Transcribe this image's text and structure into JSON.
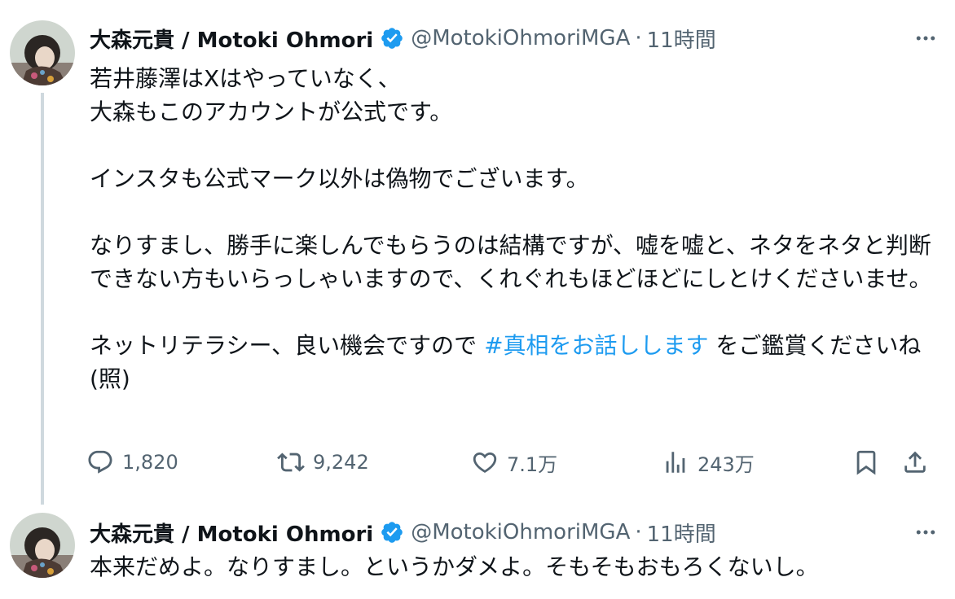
{
  "tweets": [
    {
      "display_name": "大森元貴 / Motoki Ohmori",
      "handle": "@MotokiOhmoriMGA",
      "separator": "·",
      "time": "11時間",
      "body_before_hashtag": "若井藤澤はXはやっていなく、\n大森もこのアカウントが公式です。\n\nインスタも公式マーク以外は偽物でございます。\n\nなりすまし、勝手に楽しんでもらうのは結構ですが、嘘を嘘と、ネタをネタと判断できない方もいらっしゃいますので、くれぐれもほどほどにしとけくださいませ。\n\nネットリテラシー、良い機会ですので ",
      "hashtag": "#真相をお話しします",
      "body_after_hashtag": " をご鑑賞くださいね(照)",
      "stats": {
        "replies": "1,820",
        "retweets": "9,242",
        "likes": "7.1万",
        "views": "243万"
      }
    },
    {
      "display_name": "大森元貴 / Motoki Ohmori",
      "handle": "@MotokiOhmoriMGA",
      "separator": "·",
      "time": "11時間",
      "body": "本来だめよ。なりすまし。というかダメよ。そもそもおもろくないし。"
    }
  ],
  "colors": {
    "accent": "#1d9bf0",
    "text_primary": "#0f1419",
    "text_secondary": "#536471",
    "thread_line": "#cfd9de"
  },
  "icons": [
    "verified-badge-icon",
    "more-icon",
    "reply-icon",
    "retweet-icon",
    "like-icon",
    "views-icon",
    "bookmark-icon",
    "share-icon"
  ]
}
